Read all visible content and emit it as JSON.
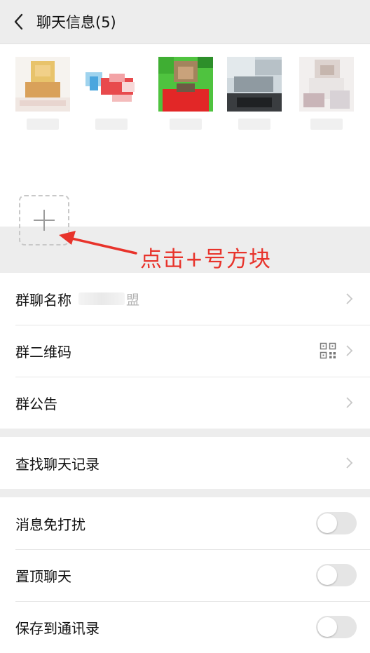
{
  "header": {
    "title": "聊天信息(5)"
  },
  "members": [
    {
      "name": ""
    },
    {
      "name": ""
    },
    {
      "name": ""
    },
    {
      "name": ""
    },
    {
      "name": ""
    }
  ],
  "annotation": {
    "text": "点击+号方块"
  },
  "settings": {
    "group_name": {
      "label": "群聊名称",
      "value": "盟"
    },
    "qr_code": {
      "label": "群二维码"
    },
    "announcement": {
      "label": "群公告"
    },
    "search_history": {
      "label": "查找聊天记录"
    },
    "mute": {
      "label": "消息免打扰",
      "on": false
    },
    "pin": {
      "label": "置顶聊天",
      "on": false
    },
    "save_contacts": {
      "label": "保存到通讯录",
      "on": false
    }
  },
  "colors": {
    "accent_red": "#e8332b",
    "toggle_off": "#e5e5e5",
    "chevron": "#c7c7c7"
  }
}
